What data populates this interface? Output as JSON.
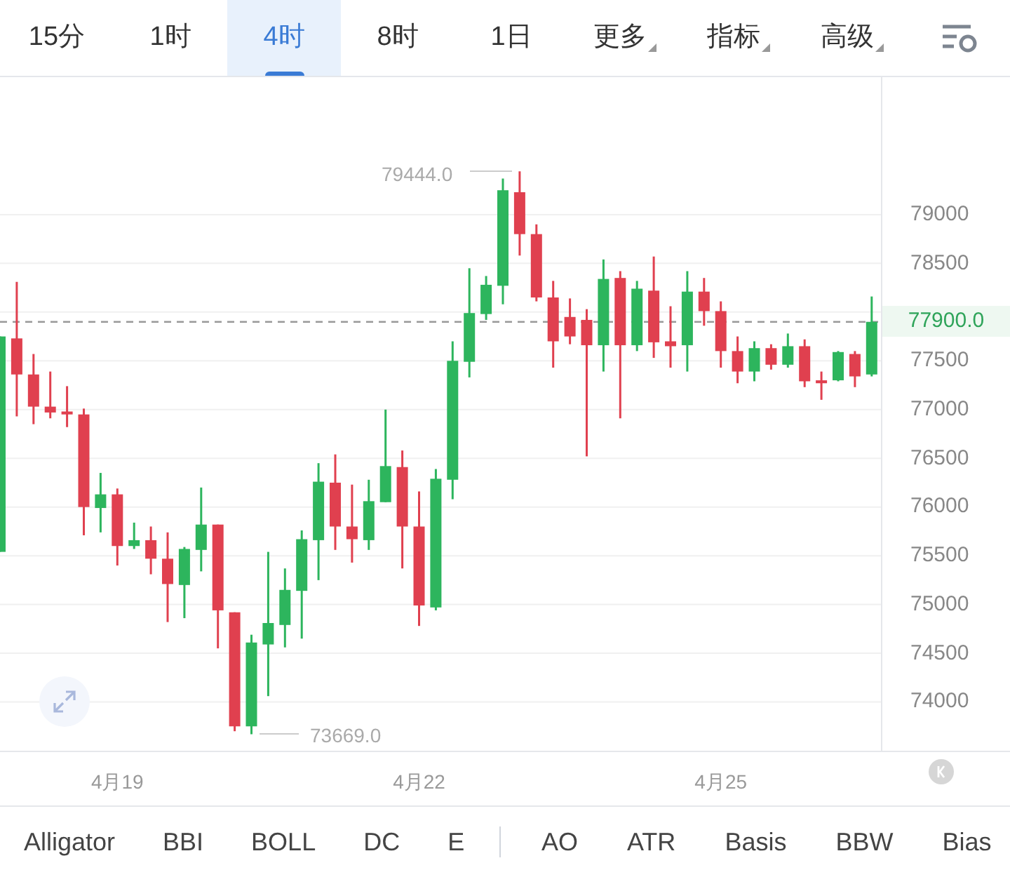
{
  "tabs": [
    {
      "label": "15分",
      "selected": false,
      "dropdown": false
    },
    {
      "label": "1时",
      "selected": false,
      "dropdown": false
    },
    {
      "label": "4时",
      "selected": true,
      "dropdown": false
    },
    {
      "label": "8时",
      "selected": false,
      "dropdown": false
    },
    {
      "label": "1日",
      "selected": false,
      "dropdown": false
    },
    {
      "label": "更多",
      "selected": false,
      "dropdown": true
    },
    {
      "label": "指标",
      "selected": false,
      "dropdown": true
    },
    {
      "label": "高级",
      "selected": false,
      "dropdown": true
    }
  ],
  "chart": {
    "high_label": "79444.0",
    "low_label": "73669.0",
    "date_labels": [
      "4月19",
      "4月22",
      "4月25"
    ],
    "chart_data": {
      "type": "candlestick",
      "grid": true,
      "ylim": [
        73500,
        80410
      ],
      "ref_lines": [
        {
          "value": 77900,
          "axis": "y",
          "label": "77900.0"
        }
      ],
      "yticks": [
        {
          "value": 79000,
          "label": "79000"
        },
        {
          "value": 78500,
          "label": "78500"
        },
        {
          "value": 77500,
          "label": "77500"
        },
        {
          "value": 77000,
          "label": "77000"
        },
        {
          "value": 76500,
          "label": "76500"
        },
        {
          "value": 76000,
          "label": "76000"
        },
        {
          "value": 75500,
          "label": "75500"
        },
        {
          "value": 75000,
          "label": "75000"
        },
        {
          "value": 74500,
          "label": "74500"
        },
        {
          "value": 74000,
          "label": "74000"
        }
      ],
      "ohlc": [
        [
          75540,
          77750,
          75540,
          77750
        ],
        [
          77730,
          78310,
          76930,
          77360
        ],
        [
          77360,
          77570,
          76850,
          77030
        ],
        [
          77030,
          77390,
          76910,
          76970
        ],
        [
          76980,
          77240,
          76820,
          76950
        ],
        [
          76950,
          77010,
          75710,
          76000
        ],
        [
          75990,
          76350,
          75740,
          76130
        ],
        [
          76130,
          76190,
          75400,
          75600
        ],
        [
          75600,
          75840,
          75570,
          75660
        ],
        [
          75660,
          75800,
          75310,
          75470
        ],
        [
          75470,
          75740,
          74820,
          75210
        ],
        [
          75200,
          75590,
          74860,
          75570
        ],
        [
          75560,
          76200,
          75340,
          75820
        ],
        [
          75820,
          75820,
          74550,
          74940
        ],
        [
          74920,
          74920,
          73700,
          73750
        ],
        [
          73750,
          74690,
          73669,
          74610
        ],
        [
          74590,
          75540,
          74060,
          74810
        ],
        [
          74790,
          75370,
          74560,
          75150
        ],
        [
          75140,
          75760,
          74650,
          75670
        ],
        [
          75660,
          76450,
          75250,
          76260
        ],
        [
          76250,
          76540,
          75560,
          75800
        ],
        [
          75800,
          76230,
          75430,
          75670
        ],
        [
          75660,
          76280,
          75560,
          76060
        ],
        [
          76050,
          77000,
          76050,
          76420
        ],
        [
          76410,
          76580,
          75370,
          75800
        ],
        [
          75800,
          76160,
          74780,
          74990
        ],
        [
          74970,
          76390,
          74940,
          76290
        ],
        [
          76280,
          77700,
          76080,
          77500
        ],
        [
          77490,
          78450,
          77330,
          77990
        ],
        [
          77980,
          78370,
          77920,
          78280
        ],
        [
          78270,
          79370,
          78080,
          79250
        ],
        [
          79230,
          79444,
          78580,
          78800
        ],
        [
          78800,
          78900,
          78110,
          78150
        ],
        [
          78150,
          78320,
          77430,
          77700
        ],
        [
          77950,
          78140,
          77670,
          77750
        ],
        [
          77920,
          78030,
          76520,
          77660
        ],
        [
          77660,
          78540,
          77390,
          78340
        ],
        [
          78350,
          78420,
          76910,
          77660
        ],
        [
          77660,
          78320,
          77600,
          78240
        ],
        [
          78220,
          78570,
          77530,
          77690
        ],
        [
          77700,
          78060,
          77430,
          77650
        ],
        [
          77660,
          78420,
          77390,
          78210
        ],
        [
          78210,
          78350,
          77860,
          78010
        ],
        [
          78010,
          78110,
          77430,
          77600
        ],
        [
          77600,
          77750,
          77270,
          77390
        ],
        [
          77390,
          77700,
          77290,
          77630
        ],
        [
          77630,
          77670,
          77410,
          77460
        ],
        [
          77460,
          77780,
          77430,
          77650
        ],
        [
          77650,
          77720,
          77230,
          77290
        ],
        [
          77300,
          77390,
          77100,
          77270
        ],
        [
          77300,
          77600,
          77290,
          77590
        ],
        [
          77570,
          77600,
          77230,
          77340
        ],
        [
          77360,
          78160,
          77340,
          77900
        ]
      ]
    }
  },
  "main_indicators": [
    "Alligator",
    "BBI",
    "BOLL",
    "DC",
    "E"
  ],
  "sub_indicators": [
    "AO",
    "ATR",
    "Basis",
    "BBW",
    "Bias"
  ]
}
